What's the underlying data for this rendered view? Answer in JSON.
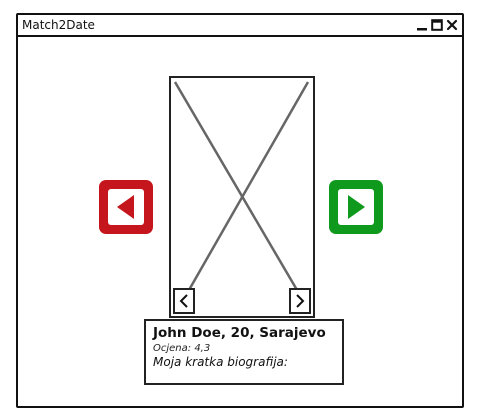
{
  "window": {
    "title": "Match2Date"
  },
  "profile": {
    "name_line": "John Doe, 20, Sarajevo",
    "rating": "Ocjena: 4,3",
    "bio_label": "Moja kratka biografija:"
  },
  "icons": {
    "prev_profile": "play-left-icon",
    "next_profile": "play-right-icon",
    "prev_photo": "chevron-left-icon",
    "next_photo": "chevron-right-icon",
    "minimize": "minimize-icon",
    "maximize": "maximize-icon",
    "close": "close-icon"
  },
  "colors": {
    "prev_button": "#c4161c",
    "next_button": "#0f9a1e"
  }
}
